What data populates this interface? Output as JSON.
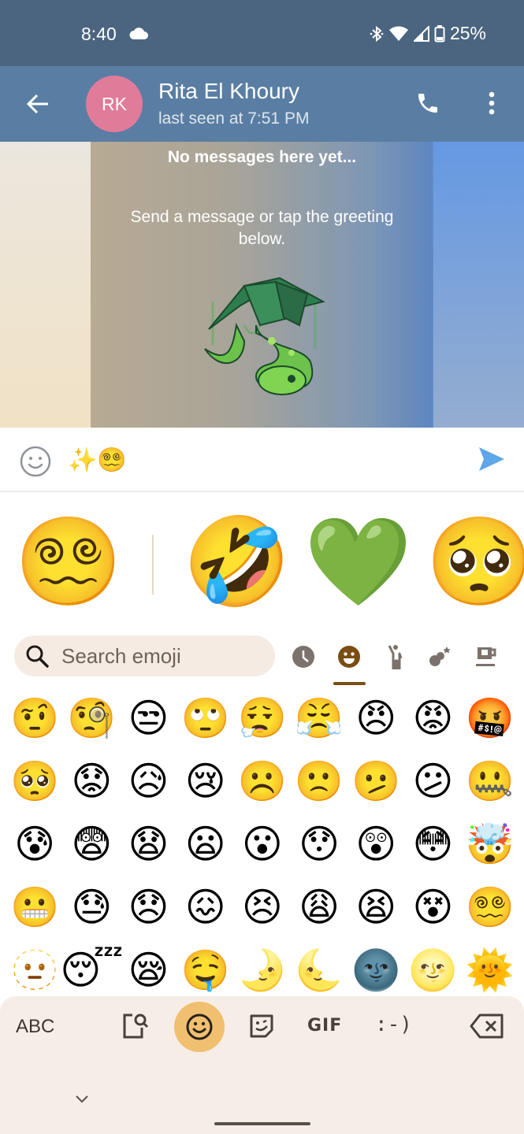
{
  "status_bar": {
    "time": "8:40",
    "battery": "25%",
    "icons": [
      "cloud-icon",
      "bluetooth-icon",
      "wifi-icon",
      "signal-icon",
      "battery-icon"
    ]
  },
  "header": {
    "avatar_initials": "RK",
    "avatar_color": "#e07b9a",
    "contact_name": "Rita El Khoury",
    "last_seen": "last seen at 7:51 PM"
  },
  "chat": {
    "empty_title": "No messages here yet...",
    "empty_subtitle": "Send a message or tap the greeting below.",
    "sticker": "plant-snake-greeting-sticker"
  },
  "composer": {
    "value": "✨😵‍💫",
    "send_color": "#5ea7e8"
  },
  "emoji_kitchen": {
    "suggestions": [
      "😵‍💫",
      "🤣",
      "💚",
      "🥺"
    ]
  },
  "emoji_search": {
    "placeholder": "Search emoji"
  },
  "categories": [
    {
      "name": "recent",
      "active": false
    },
    {
      "name": "smileys",
      "active": true
    },
    {
      "name": "people",
      "active": false
    },
    {
      "name": "nature",
      "active": false
    },
    {
      "name": "food",
      "active": false
    }
  ],
  "emoji_grid": [
    "🤨",
    "🧐",
    "😒",
    "🙄",
    "😮‍💨",
    "😤",
    "😠",
    "😡",
    "🤬",
    "🥺",
    "😟",
    "😥",
    "😢",
    "☹️",
    "🙁",
    "🫤",
    "😕",
    "🤐",
    "😰",
    "😨",
    "😧",
    "😦",
    "😮",
    "😯",
    "😲",
    "😳",
    "🤯",
    "😬",
    "😓",
    "😞",
    "😖",
    "😣",
    "😩",
    "😫",
    "😵",
    "😵‍💫",
    "🫥",
    "😴",
    "😪",
    "🤤",
    "🌛",
    "🌜",
    "🌚",
    "🌝",
    "🌞"
  ],
  "keyboard_bar": {
    "abc_label": "ABC",
    "gif_label": "GIF",
    "emoticon_label": ":-)",
    "accent_color": "#f0c070"
  }
}
